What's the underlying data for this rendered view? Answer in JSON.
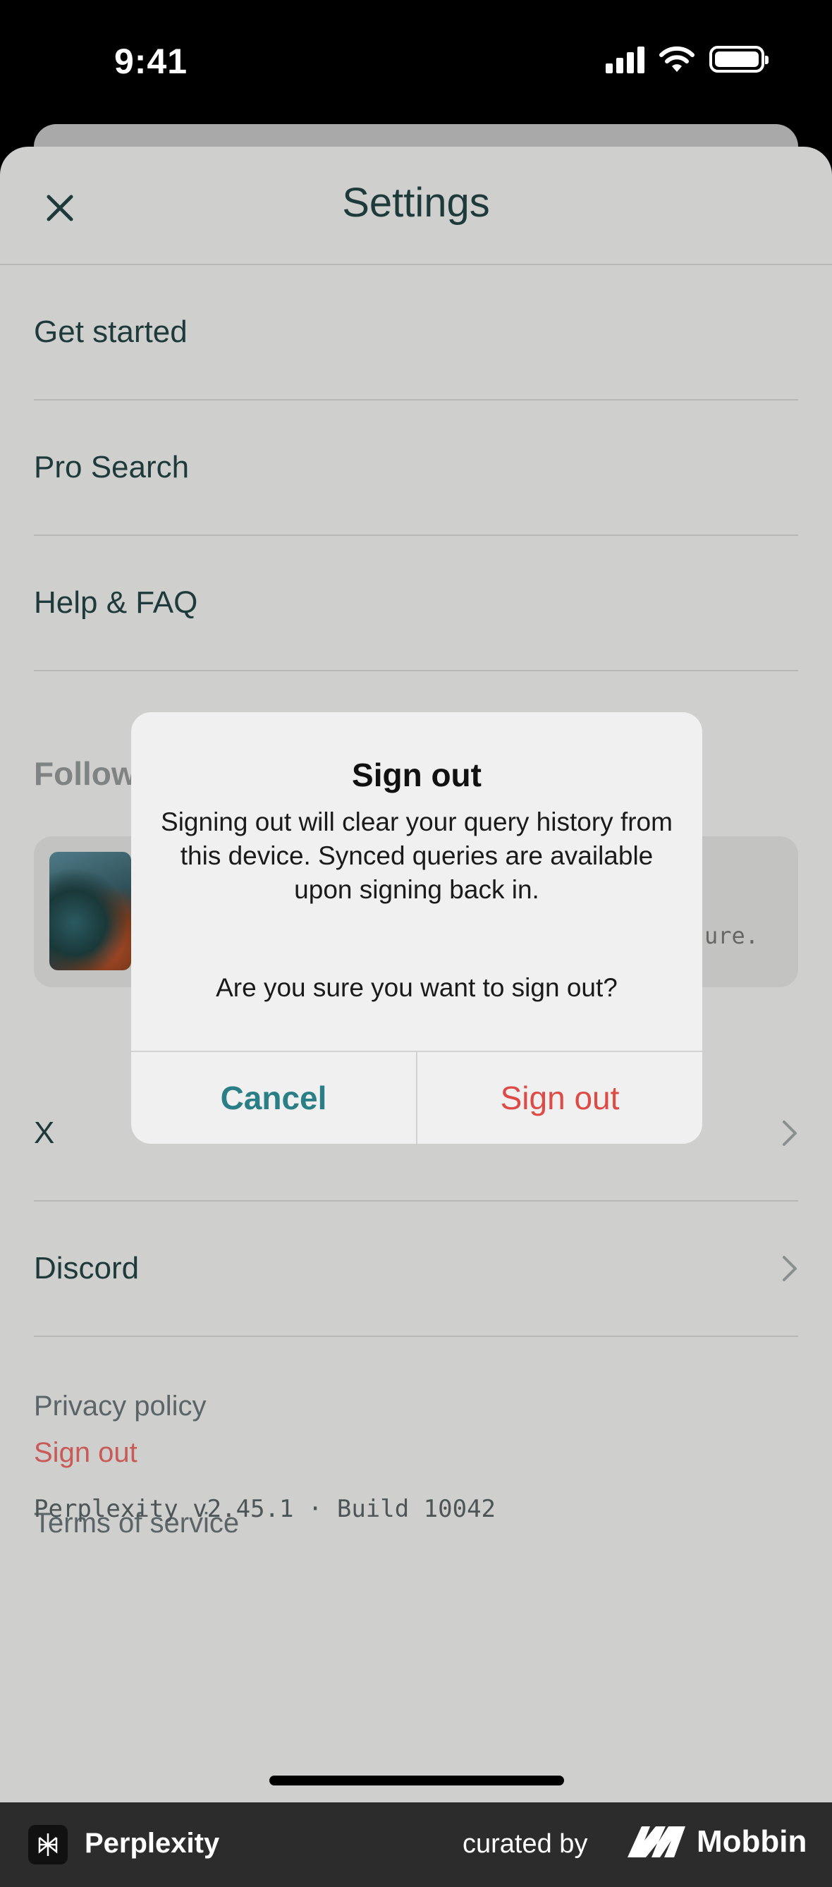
{
  "status": {
    "time": "9:41"
  },
  "header": {
    "title": "Settings"
  },
  "menu": {
    "items": [
      {
        "label": "Get started"
      },
      {
        "label": "Pro Search"
      },
      {
        "label": "Help & FAQ"
      }
    ]
  },
  "follow": {
    "heading": "Follow",
    "card_snippet": "ure."
  },
  "social": {
    "items": [
      {
        "label": "X"
      },
      {
        "label": "Discord"
      }
    ]
  },
  "footer": {
    "privacy": "Privacy policy",
    "terms": "Terms of service",
    "sign_out": "Sign out",
    "version": "Perplexity v2.45.1 · Build 10042"
  },
  "alert": {
    "title": "Sign out",
    "message": "Signing out will clear your query history from this device. Synced queries are available upon signing back in.",
    "question": "Are you sure you want to sign out?",
    "cancel_label": "Cancel",
    "confirm_label": "Sign out"
  },
  "watermark": {
    "app_name": "Perplexity",
    "curated_by": "curated by",
    "brand": "Mobbin"
  },
  "colors": {
    "accent_teal": "#2a7f86",
    "destructive_red": "#de4a45",
    "text_dark": "#1f3a3a"
  }
}
